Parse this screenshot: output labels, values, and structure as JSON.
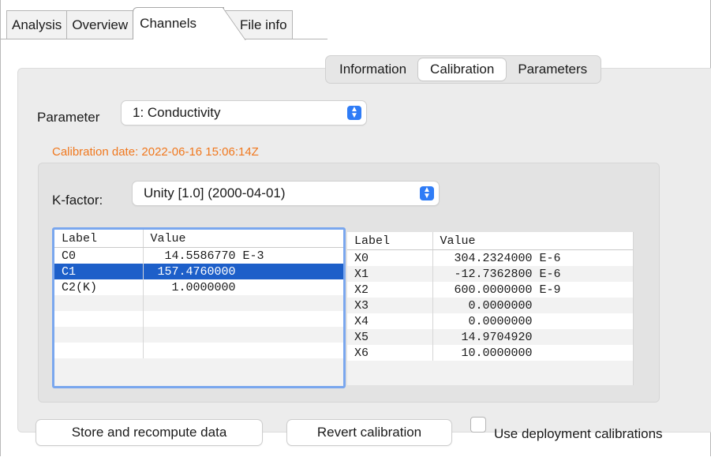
{
  "top_tabs": [
    "Analysis",
    "Overview",
    "Channels",
    "File info"
  ],
  "active_top_tab": "Channels",
  "sub_tabs": [
    "Information",
    "Calibration",
    "Parameters"
  ],
  "active_sub_tab": "Calibration",
  "parameter": {
    "label": "Parameter",
    "value": "1: Conductivity"
  },
  "calibration_date": "Calibration date: 2022-06-16 15:06:14Z",
  "kfactor": {
    "label": "K-factor:",
    "value": "Unity [1.0] (2000-04-01)"
  },
  "left_table": {
    "headers": [
      "Label",
      "Value"
    ],
    "rows": [
      [
        "C0",
        "  14.5586770 E-3"
      ],
      [
        "C1",
        " 157.4760000"
      ],
      [
        "C2(K)",
        "   1.0000000"
      ],
      [
        "",
        ""
      ],
      [
        "",
        ""
      ],
      [
        "",
        ""
      ],
      [
        "",
        ""
      ]
    ],
    "selected_row": 1
  },
  "right_table": {
    "headers": [
      "Label",
      "Value"
    ],
    "rows": [
      [
        "X0",
        "  304.2324000 E-6"
      ],
      [
        "X1",
        "  -12.7362800 E-6"
      ],
      [
        "X2",
        "  600.0000000 E-9"
      ],
      [
        "X3",
        "    0.0000000"
      ],
      [
        "X4",
        "    0.0000000"
      ],
      [
        "X5",
        "   14.9704920"
      ],
      [
        "X6",
        "   10.0000000"
      ]
    ]
  },
  "buttons": {
    "store": "Store and recompute data",
    "revert": "Revert calibration"
  },
  "checkbox": {
    "label": "Use deployment calibrations",
    "checked": false
  }
}
